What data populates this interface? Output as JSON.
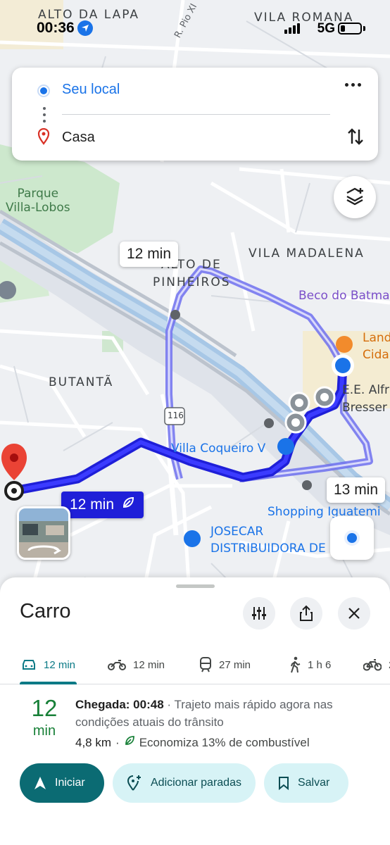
{
  "status_bar": {
    "time": "00:36",
    "carrier": "5G"
  },
  "search": {
    "origin": "Seu local",
    "destination": "Casa"
  },
  "map": {
    "labels": {
      "alto_da_lapa": "ALTO DA LAPA",
      "vila_romana": "VILA ROMANA",
      "rua_pio": "R. Pio XI",
      "parque": "Parque\nVilla-Lobos",
      "vila_madalena": "VILA MADALENA",
      "alto_de_pinheiros_1": "ALTO DE",
      "alto_de_pinheiros_2": "PINHEIROS",
      "beco": "Beco do Batma",
      "land_1": "Land",
      "land_2": "Cida",
      "escola_1": "E.E. Alfr",
      "escola_2": "Bresser",
      "butanta": "BUTANTÃ",
      "route_116": "116",
      "villa_coqueiro": "Villa Coqueiro V",
      "shopping": "Shopping Iguatemi",
      "josecar_1": "JOSECAR",
      "josecar_2": "DISTRIBUIDORA DE"
    },
    "route_badges": {
      "alt_north": "12 min",
      "alt_east": "13 min",
      "main": "12 min"
    }
  },
  "sheet": {
    "title": "Carro",
    "modes": [
      {
        "icon": "car-icon",
        "label": "12 min",
        "active": true
      },
      {
        "icon": "motorcycle-icon",
        "label": "12 min",
        "active": false
      },
      {
        "icon": "train-icon",
        "label": "27 min",
        "active": false
      },
      {
        "icon": "walk-icon",
        "label": "1 h 6",
        "active": false
      },
      {
        "icon": "bike-icon",
        "label": "2",
        "active": false
      }
    ],
    "eta_value": "12",
    "eta_unit": "min",
    "arrival_label": "Chegada: 00:48",
    "arrival_note": " · Trajeto mais rápido agora nas condições atuais do trânsito",
    "distance": "4,8 km",
    "separator": "·",
    "fuel_saving": "Economiza 13% de combustível",
    "actions": {
      "start": "Iniciar",
      "add_stops": "Adicionar paradas",
      "save": "Salvar"
    }
  },
  "colors": {
    "route_main": "#1f1fd8",
    "route_alt": "#8a8cf2",
    "accent": "#0b7a86",
    "eta_green": "#188038",
    "location_blue": "#1a73e8"
  }
}
